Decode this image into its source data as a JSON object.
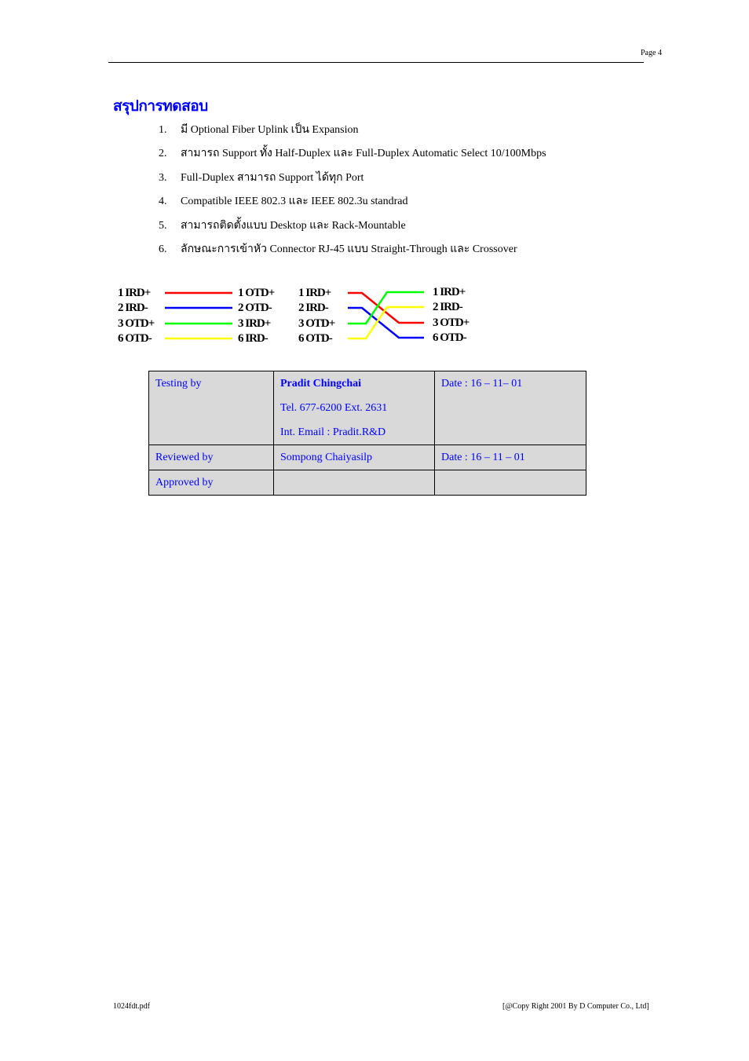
{
  "header": {
    "page_label": "Page  4"
  },
  "section_title": "สรุปการทดสอบ",
  "summary_items": [
    {
      "num": "1.",
      "text": "มี Optional Fiber Uplink เป็น Expansion"
    },
    {
      "num": "2.",
      "text": "สามารถ Support ทั้ง Half-Duplex และ Full-Duplex Automatic Select 10/100Mbps"
    },
    {
      "num": "3.",
      "text": "Full-Duplex สามารถ Support ได้ทุก Port"
    },
    {
      "num": "4.",
      "text": "Compatible IEEE 802.3 และ IEEE 802.3u standrad"
    },
    {
      "num": "5.",
      "text": "สามารถติดตั้งแบบ Desktop และ Rack-Mountable"
    },
    {
      "num": "6.",
      "text": "ลักษณะการเข้าหัว Connector RJ-45 แบบ Straight-Through และ Crossover"
    }
  ],
  "wiring": {
    "colors": {
      "red": "#ff0000",
      "blue": "#0000ff",
      "green": "#00ff00",
      "yellow": "#ffff00"
    },
    "straight": {
      "left": [
        "1 IRD+",
        "2 IRD-",
        "3 OTD+",
        "6 OTD-"
      ],
      "right": [
        "1 OTD+",
        "2 OTD-",
        "3 IRD+",
        "6 IRD-"
      ],
      "wires": [
        "red",
        "blue",
        "green",
        "yellow"
      ]
    },
    "crossover": {
      "left": [
        "1 IRD+",
        "2 IRD-",
        "3 OTD+",
        "6 OTD-"
      ],
      "right": [
        "1 IRD+",
        "2 IRD-",
        "3 OTD+",
        "6 OTD-"
      ],
      "wires": [
        {
          "color": "red",
          "from": 0,
          "to": 2
        },
        {
          "color": "blue",
          "from": 1,
          "to": 3
        },
        {
          "color": "green",
          "from": 2,
          "to": 0
        },
        {
          "color": "yellow",
          "from": 3,
          "to": 1
        }
      ]
    }
  },
  "signoff": {
    "testing": {
      "label": "Testing by",
      "name": "Pradit Chingchai",
      "tel": "Tel. 677-6200 Ext. 2631",
      "email": "Int. Email : Pradit.R&D",
      "date": "Date : 16 – 11– 01"
    },
    "reviewed": {
      "label": "Reviewed by",
      "name": "Sompong Chaiyasilp",
      "date": "Date : 16 – 11 – 01"
    },
    "approved": {
      "label": "Approved by",
      "name": "",
      "date": ""
    }
  },
  "footer": {
    "filename": "1024fdt.pdf",
    "copyright": "[@Copy Right 2001 By D Computer Co., Ltd]"
  }
}
